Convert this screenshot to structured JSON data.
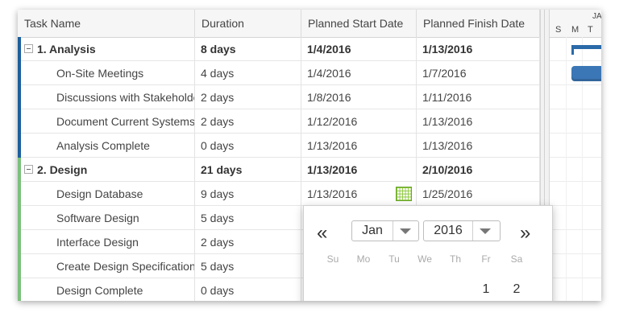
{
  "columns": [
    "Task Name",
    "Duration",
    "Planned Start Date",
    "Planned Finish Date"
  ],
  "rows": [
    {
      "name": "1. Analysis",
      "duration": "8 days",
      "start": "1/4/2016",
      "finish": "1/13/2016",
      "summary": true,
      "group": "blue"
    },
    {
      "name": "On-Site Meetings",
      "duration": "4 days",
      "start": "1/4/2016",
      "finish": "1/7/2016",
      "summary": false,
      "group": "blue"
    },
    {
      "name": "Discussions with Stakeholders",
      "duration": "2 days",
      "start": "1/8/2016",
      "finish": "1/11/2016",
      "summary": false,
      "group": "blue"
    },
    {
      "name": "Document Current Systems",
      "duration": "2 days",
      "start": "1/12/2016",
      "finish": "1/13/2016",
      "summary": false,
      "group": "blue"
    },
    {
      "name": "Analysis Complete",
      "duration": "0 days",
      "start": "1/13/2016",
      "finish": "1/13/2016",
      "summary": false,
      "group": "blue"
    },
    {
      "name": "2. Design",
      "duration": "21 days",
      "start": "1/13/2016",
      "finish": "2/10/2016",
      "summary": true,
      "group": "green"
    },
    {
      "name": "Design Database",
      "duration": "9 days",
      "start": "1/13/2016",
      "finish": "1/25/2016",
      "summary": false,
      "group": "green",
      "editing": true
    },
    {
      "name": "Software Design",
      "duration": "5 days",
      "start": "",
      "finish": "",
      "summary": false,
      "group": "green"
    },
    {
      "name": "Interface Design",
      "duration": "2 days",
      "start": "",
      "finish": "",
      "summary": false,
      "group": "green"
    },
    {
      "name": "Create Design Specification",
      "duration": "5 days",
      "start": "",
      "finish": "",
      "summary": false,
      "group": "green"
    },
    {
      "name": "Design Complete",
      "duration": "0 days",
      "start": "",
      "finish": "",
      "summary": false,
      "group": "green"
    }
  ],
  "gantt": {
    "month": "JA",
    "days": [
      "S",
      "M",
      "T"
    ]
  },
  "datepicker": {
    "prev": "«",
    "next": "»",
    "month": "Jan",
    "year": "2016",
    "weekdays": [
      "Su",
      "Mo",
      "Tu",
      "We",
      "Th",
      "Fr",
      "Sa"
    ],
    "first_row": [
      "",
      "",
      "",
      "",
      "",
      "1",
      "2"
    ]
  },
  "icons": {
    "expander": "collapse-icon",
    "date_picker": "calendar-icon"
  },
  "colors": {
    "analysis_group": "#1c5f9c",
    "design_group": "#7cbf7c",
    "gantt_bar": "#3b77b6"
  }
}
